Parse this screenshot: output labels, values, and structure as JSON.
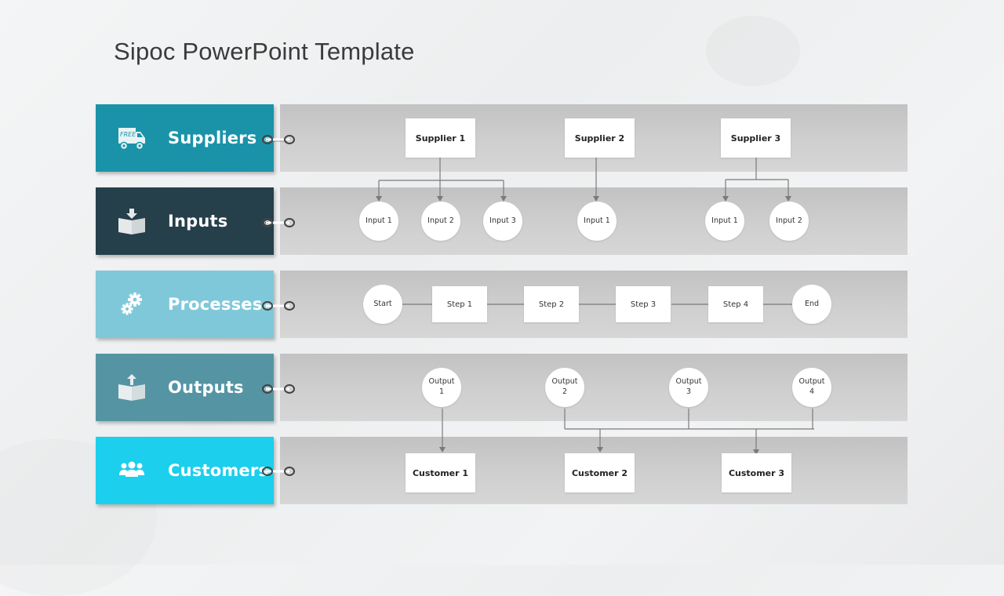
{
  "title": "Sipoc PowerPoint Template",
  "colors": {
    "suppliers": "#1a93a9",
    "inputs": "#253f4b",
    "processes": "#7fc8da",
    "outputs": "#5595a3",
    "customers": "#1ccfec",
    "connector_line": "#7a7a7a"
  },
  "rows": [
    {
      "id": "suppliers",
      "label": "Suppliers",
      "icon": "delivery-truck-icon",
      "icon_text": "FREE"
    },
    {
      "id": "inputs",
      "label": "Inputs",
      "icon": "box-arrow-in-icon"
    },
    {
      "id": "processes",
      "label": "Processes",
      "icon": "gears-icon"
    },
    {
      "id": "outputs",
      "label": "Outputs",
      "icon": "box-arrow-out-icon"
    },
    {
      "id": "customers",
      "label": "Customers",
      "icon": "users-group-icon"
    }
  ],
  "suppliers": [
    "Supplier  1",
    "Supplier  2",
    "Supplier  3"
  ],
  "inputs": [
    {
      "label": "Input 1",
      "supplier": 0
    },
    {
      "label": "Input 2",
      "supplier": 0
    },
    {
      "label": "Input 3",
      "supplier": 0
    },
    {
      "label": "Input 1",
      "supplier": 1
    },
    {
      "label": "Input 1",
      "supplier": 2
    },
    {
      "label": "Input 2",
      "supplier": 2
    }
  ],
  "processes": {
    "start": "Start",
    "steps": [
      "Step 1",
      "Step 2",
      "Step 3",
      "Step 4"
    ],
    "end": "End"
  },
  "outputs": [
    {
      "line1": "Output",
      "line2": "1"
    },
    {
      "line1": "Output",
      "line2": "2"
    },
    {
      "line1": "Output",
      "line2": "3"
    },
    {
      "line1": "Output",
      "line2": "4"
    }
  ],
  "customers": [
    "Customer 1",
    "Customer 2",
    "Customer 3"
  ],
  "flows": {
    "output_to_customer": [
      {
        "outputs": [
          0
        ],
        "customer": 0
      },
      {
        "outputs": [
          1,
          2,
          3
        ],
        "customers": [
          1,
          2
        ]
      }
    ]
  }
}
